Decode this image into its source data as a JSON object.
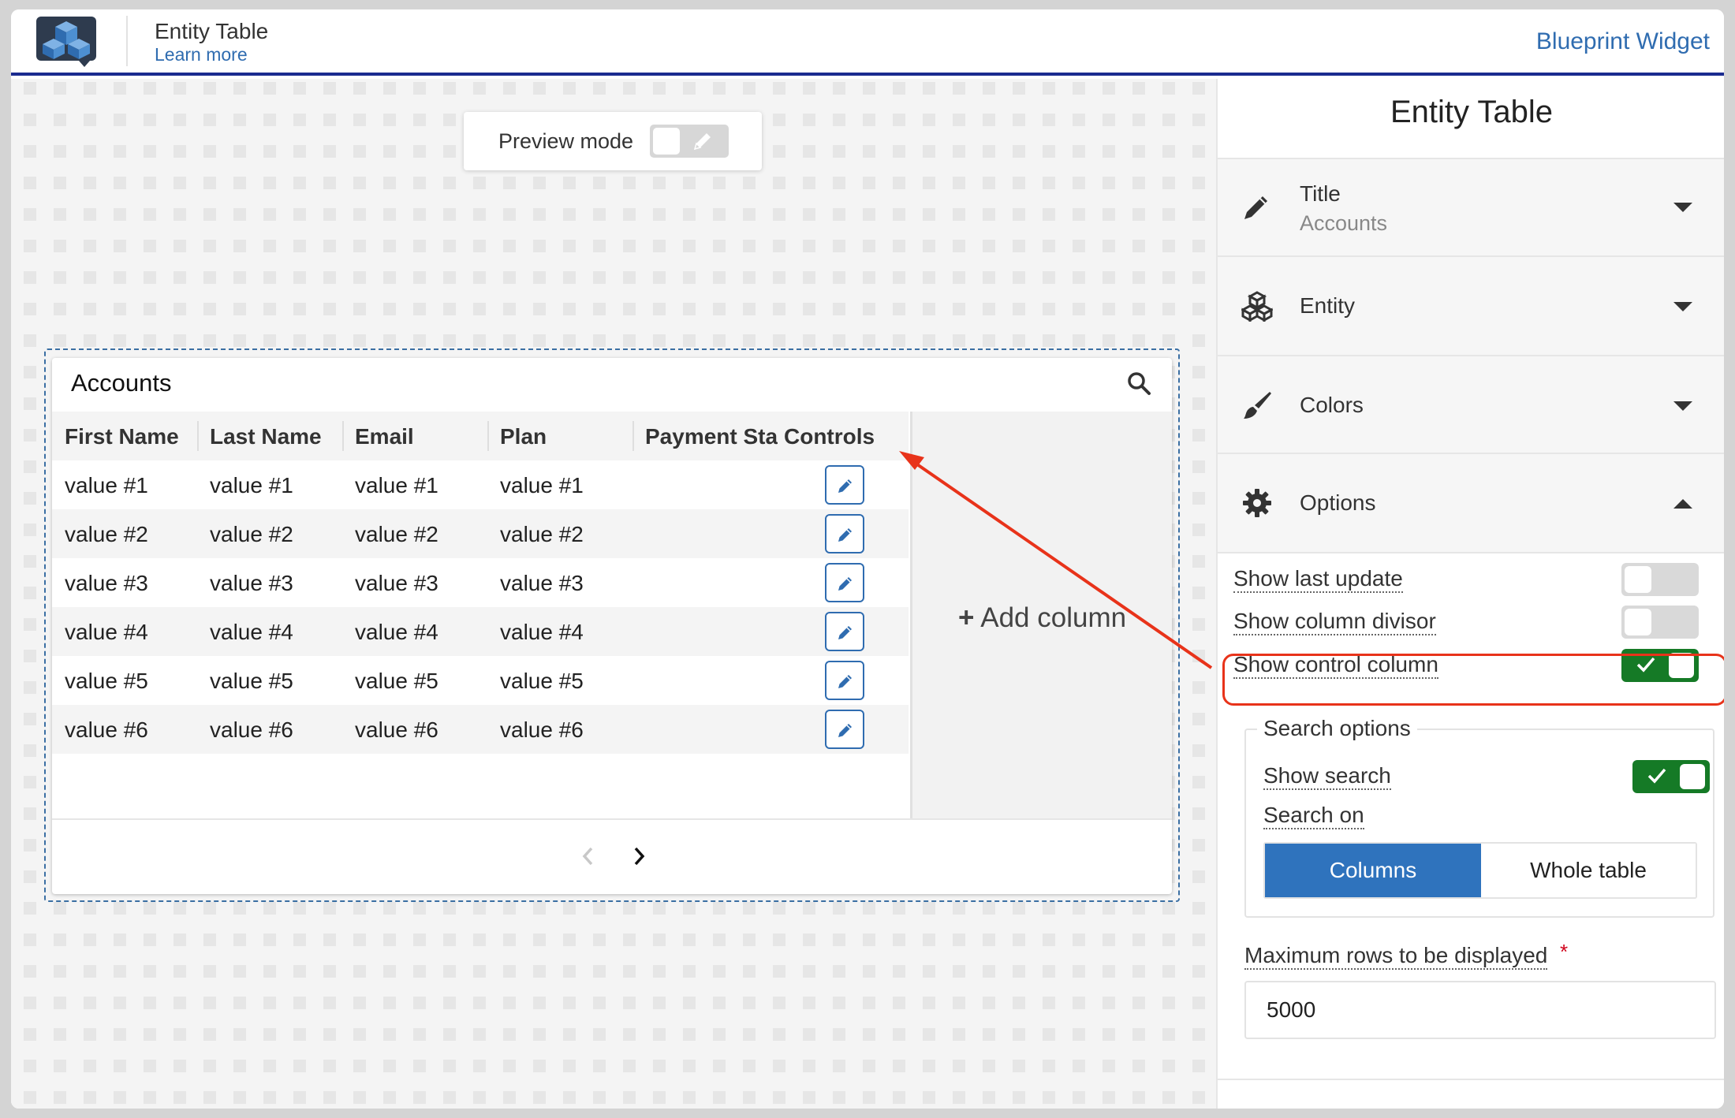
{
  "header": {
    "title": "Entity Table",
    "learn_more": "Learn more",
    "right_link": "Blueprint Widget",
    "logo_icon": "cubes-logo-icon"
  },
  "preview": {
    "label": "Preview mode",
    "enabled": false,
    "icon": "pencil-icon"
  },
  "widget": {
    "title": "Accounts",
    "search_icon": "search-icon",
    "columns": [
      "First Name",
      "Last Name",
      "Email",
      "Plan",
      "Payment Status",
      "Controls"
    ],
    "rows": [
      [
        "value #1",
        "value #1",
        "value #1",
        "value #1",
        ""
      ],
      [
        "value #2",
        "value #2",
        "value #2",
        "value #2",
        ""
      ],
      [
        "value #3",
        "value #3",
        "value #3",
        "value #3",
        ""
      ],
      [
        "value #4",
        "value #4",
        "value #4",
        "value #4",
        ""
      ],
      [
        "value #5",
        "value #5",
        "value #5",
        "value #5",
        ""
      ],
      [
        "value #6",
        "value #6",
        "value #6",
        "value #6",
        ""
      ]
    ],
    "add_column": "Add column",
    "pager": {
      "prev_icon": "chevron-left-icon",
      "next_icon": "chevron-right-icon"
    }
  },
  "panel": {
    "title": "Entity Table",
    "sections": {
      "title": {
        "label": "Title",
        "value": "Accounts",
        "icon": "pencil-icon",
        "expanded": false
      },
      "entity": {
        "label": "Entity",
        "icon": "cubes-icon",
        "expanded": false
      },
      "colors": {
        "label": "Colors",
        "icon": "brush-icon",
        "expanded": false
      },
      "options": {
        "label": "Options",
        "icon": "gear-icon",
        "expanded": true
      }
    },
    "options": {
      "show_last_update": {
        "label": "Show last update",
        "on": false
      },
      "show_column_divisor": {
        "label": "Show column divisor",
        "on": false
      },
      "show_control_column": {
        "label": "Show control column",
        "on": true
      }
    },
    "search_options": {
      "legend": "Search options",
      "show_search": {
        "label": "Show search",
        "on": true
      },
      "search_on": {
        "label": "Search on",
        "choices": [
          "Columns",
          "Whole table"
        ],
        "selected": "Columns"
      }
    },
    "max_rows": {
      "label": "Maximum rows to be displayed",
      "required_mark": "*",
      "value": "5000"
    }
  },
  "colors": {
    "accent": "#2f6cb0",
    "header_rule": "#1a2b8f",
    "toggle_on": "#157a26",
    "annotation": "#e8331a",
    "segment_selected": "#2f73bd"
  }
}
